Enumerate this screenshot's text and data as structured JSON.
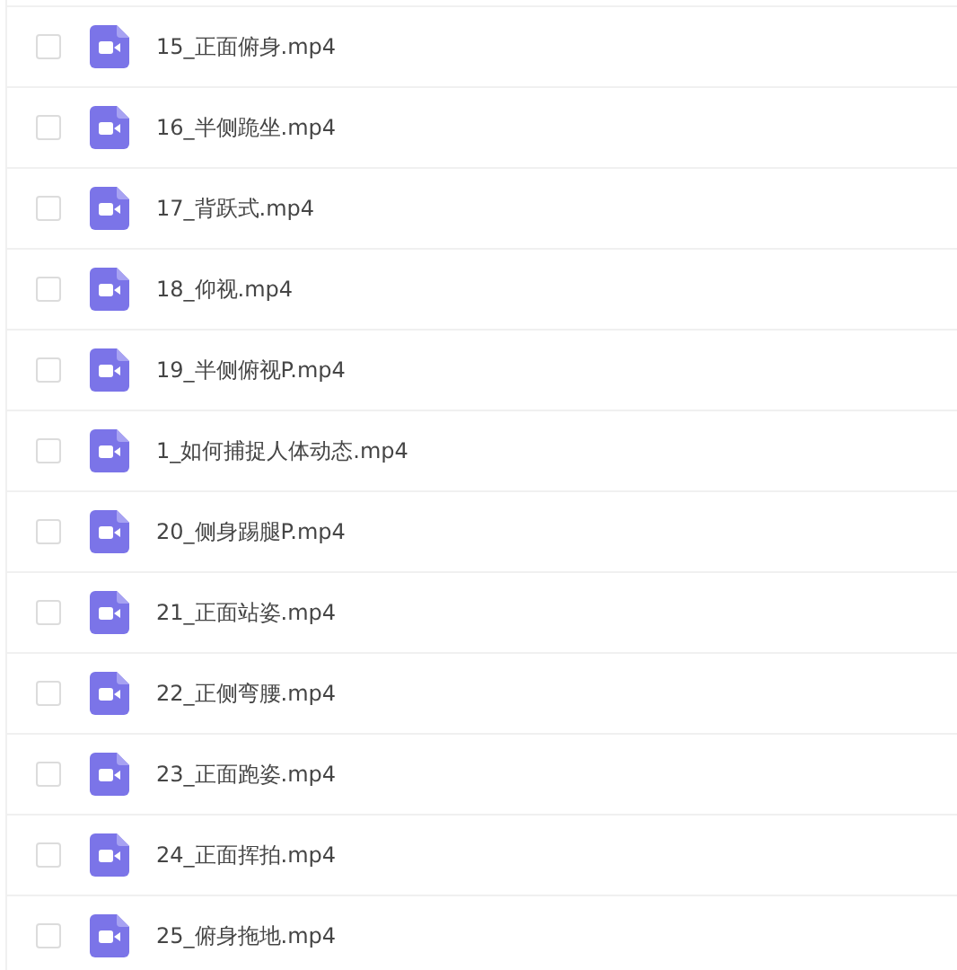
{
  "files": [
    {
      "name": "15_正面俯身.mp4",
      "checked": false
    },
    {
      "name": "16_半侧跪坐.mp4",
      "checked": false
    },
    {
      "name": "17_背跃式.mp4",
      "checked": false
    },
    {
      "name": "18_仰视.mp4",
      "checked": false
    },
    {
      "name": "19_半侧俯视P.mp4",
      "checked": false
    },
    {
      "name": "1_如何捕捉人体动态.mp4",
      "checked": false
    },
    {
      "name": "20_侧身踢腿P.mp4",
      "checked": false
    },
    {
      "name": "21_正面站姿.mp4",
      "checked": false
    },
    {
      "name": "22_正侧弯腰.mp4",
      "checked": false
    },
    {
      "name": "23_正面跑姿.mp4",
      "checked": false
    },
    {
      "name": "24_正面挥拍.mp4",
      "checked": false
    },
    {
      "name": "25_俯身拖地.mp4",
      "checked": false
    }
  ]
}
